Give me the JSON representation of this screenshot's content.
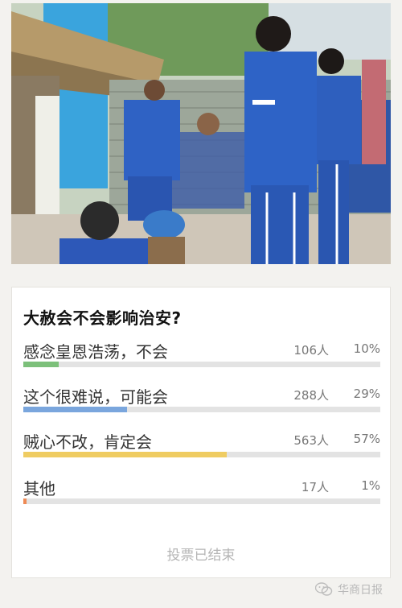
{
  "photo": {
    "alt_icon": "prison-yard-photo"
  },
  "poll": {
    "title": "大赦会不会影响治安?",
    "options": [
      {
        "label": "感念皇恩浩荡，不会",
        "count": "106人",
        "percent": "10%",
        "share": 0.1,
        "color": "#7cc07a"
      },
      {
        "label": "这个很难说，可能会",
        "count": "288人",
        "percent": "29%",
        "share": 0.29,
        "color": "#7aa6dd"
      },
      {
        "label": "贼心不改，肯定会",
        "count": "563人",
        "percent": "57%",
        "share": 0.57,
        "color": "#efcc62"
      },
      {
        "label": "其他",
        "count": "17人",
        "percent": "1%",
        "share": 0.01,
        "color": "#ee8a55"
      }
    ],
    "status": "投票已结束"
  },
  "watermark": {
    "text": "华商日报",
    "icon": "wechat-icon"
  }
}
